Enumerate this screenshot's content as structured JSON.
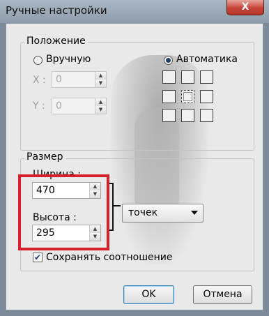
{
  "window": {
    "title": "Ручные настройки",
    "close_label": "X"
  },
  "position": {
    "group_label": "Положение",
    "manual_label": "Вручную",
    "auto_label": "Автоматика",
    "x_label": "X :",
    "x_value": "0",
    "y_label": "Y :",
    "y_value": "0",
    "selected_mode": "auto",
    "grid_selected": "center"
  },
  "size": {
    "group_label": "Размер",
    "width_label": "Ширина :",
    "width_value": "470",
    "height_label": "Высота :",
    "height_value": "295",
    "unit_selected": "точек",
    "keep_ratio_label": "Сохранять соотношение",
    "keep_ratio_checked": true
  },
  "buttons": {
    "ok": "OK",
    "cancel": "Отмена"
  },
  "colors": {
    "highlight": "#d8202c",
    "titlebar": "#9aa8b7",
    "close": "#c8443a"
  },
  "icons": {
    "check": "✔"
  }
}
